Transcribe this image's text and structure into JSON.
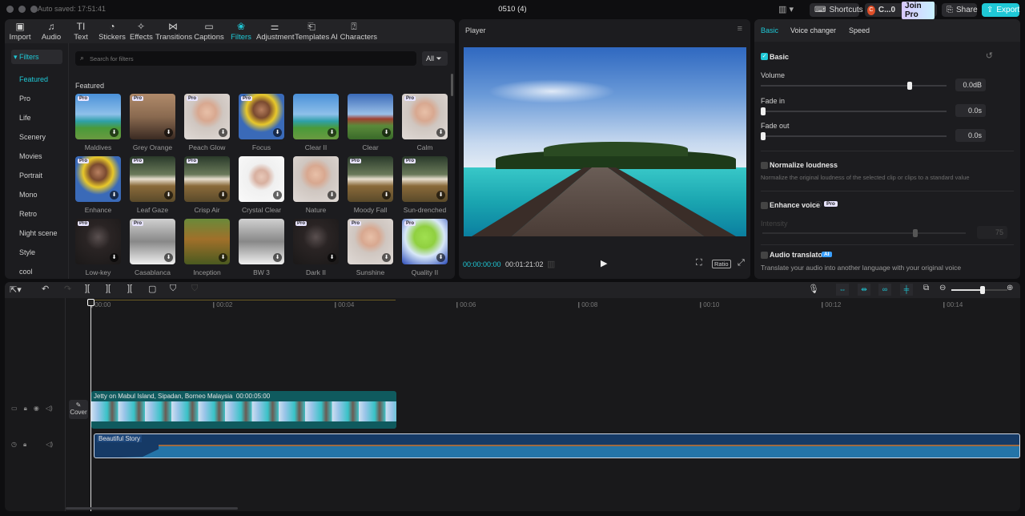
{
  "titlebar": {
    "autosave": "Auto saved: 17:51:41",
    "project": "0510 (4)",
    "shortcuts": "Shortcuts",
    "user": "C...0",
    "user_initial": "C",
    "join_pro": "Join Pro",
    "share": "Share",
    "export": "Export"
  },
  "tools": [
    {
      "label": "Import",
      "icon": "▣"
    },
    {
      "label": "Audio",
      "icon": "♫"
    },
    {
      "label": "Text",
      "icon": "TI"
    },
    {
      "label": "Stickers",
      "icon": "◔"
    },
    {
      "label": "Effects",
      "icon": "✧"
    },
    {
      "label": "Transitions",
      "icon": "⋈"
    },
    {
      "label": "Captions",
      "icon": "▭"
    },
    {
      "label": "Filters",
      "icon": "❀",
      "active": true
    },
    {
      "label": "Adjustment",
      "icon": "⚌"
    },
    {
      "label": "Templates",
      "icon": "⎗"
    },
    {
      "label": "AI Characters",
      "icon": "⍰"
    }
  ],
  "filters": {
    "section": "▾ Filters",
    "categories": [
      "Featured",
      "Pro",
      "Life",
      "Scenery",
      "Movies",
      "Portrait",
      "Mono",
      "Retro",
      "Night scene",
      "Style",
      "cool"
    ],
    "search_placeholder": "Search for filters",
    "all_label": "All",
    "heading": "Featured",
    "pro_badge": "Pro",
    "items": [
      {
        "name": "Maldives",
        "pro": true,
        "kind": "beach"
      },
      {
        "name": "Grey Orange",
        "pro": true,
        "kind": "brown"
      },
      {
        "name": "Peach Glow",
        "pro": true,
        "kind": "portrait"
      },
      {
        "name": "Focus",
        "pro": true,
        "kind": "yellow"
      },
      {
        "name": "Clear II",
        "pro": false,
        "kind": "beach"
      },
      {
        "name": "Clear",
        "pro": false,
        "kind": "house"
      },
      {
        "name": "Calm",
        "pro": true,
        "kind": "portrait"
      },
      {
        "name": "Enhance",
        "pro": true,
        "kind": "yellow"
      },
      {
        "name": "Leaf Gaze",
        "pro": true,
        "kind": "field"
      },
      {
        "name": "Crisp Air",
        "pro": true,
        "kind": "field"
      },
      {
        "name": "Crystal Clear",
        "pro": false,
        "kind": "white"
      },
      {
        "name": "Nature",
        "pro": false,
        "kind": "portrait"
      },
      {
        "name": "Moody Fall",
        "pro": true,
        "kind": "field"
      },
      {
        "name": "Sun-drenched",
        "pro": true,
        "kind": "field"
      },
      {
        "name": "Low-key",
        "pro": true,
        "kind": "dark"
      },
      {
        "name": "Casablanca",
        "pro": true,
        "kind": "bw"
      },
      {
        "name": "Inception",
        "pro": false,
        "kind": "park"
      },
      {
        "name": "BW 3",
        "pro": false,
        "kind": "bw"
      },
      {
        "name": "Dark II",
        "pro": true,
        "kind": "dark"
      },
      {
        "name": "Sunshine",
        "pro": true,
        "kind": "portrait"
      },
      {
        "name": "Quality II",
        "pro": true,
        "kind": "green"
      }
    ]
  },
  "player": {
    "title": "Player",
    "current": "00:00:00:00",
    "total": "00:01:21:02",
    "ratio": "Ratio"
  },
  "inspector": {
    "tabs": [
      "Basic",
      "Voice changer",
      "Speed"
    ],
    "basic_label": "Basic",
    "volume_label": "Volume",
    "volume_value": "0.0dB",
    "volume_level": 0.8,
    "fade_in_label": "Fade in",
    "fade_in_value": "0.0s",
    "fade_out_label": "Fade out",
    "fade_out_value": "0.0s",
    "normalize_label": "Normalize loudness",
    "normalize_desc": "Normalize the original loudness of the selected clip or clips to a standard value",
    "enhance_label": "Enhance voice",
    "enhance_badge": "Pro",
    "intensity_label": "Intensity",
    "intensity_value": "75",
    "intensity_level": 0.75,
    "translator_label": "Audio translator",
    "translator_badge": "AI",
    "translator_desc": "Translate your audio into another language with your original voice"
  },
  "timeline": {
    "ruler": [
      "00:00",
      "00:02",
      "00:04",
      "00:06",
      "00:08",
      "00:10",
      "00:12",
      "00:14"
    ],
    "cover": "Cover",
    "video_clip": {
      "title": "Jetty on Mabul Island, Sipadan, Borneo Malaysia",
      "duration": "00:00:05:00"
    },
    "audio_clip": {
      "title": "Beautiful Story"
    },
    "zoom_level": 0.55
  },
  "colors": {
    "accent": "#1fc8d6",
    "clip_video": "#0f5a5e",
    "clip_audio": "#163a66"
  }
}
